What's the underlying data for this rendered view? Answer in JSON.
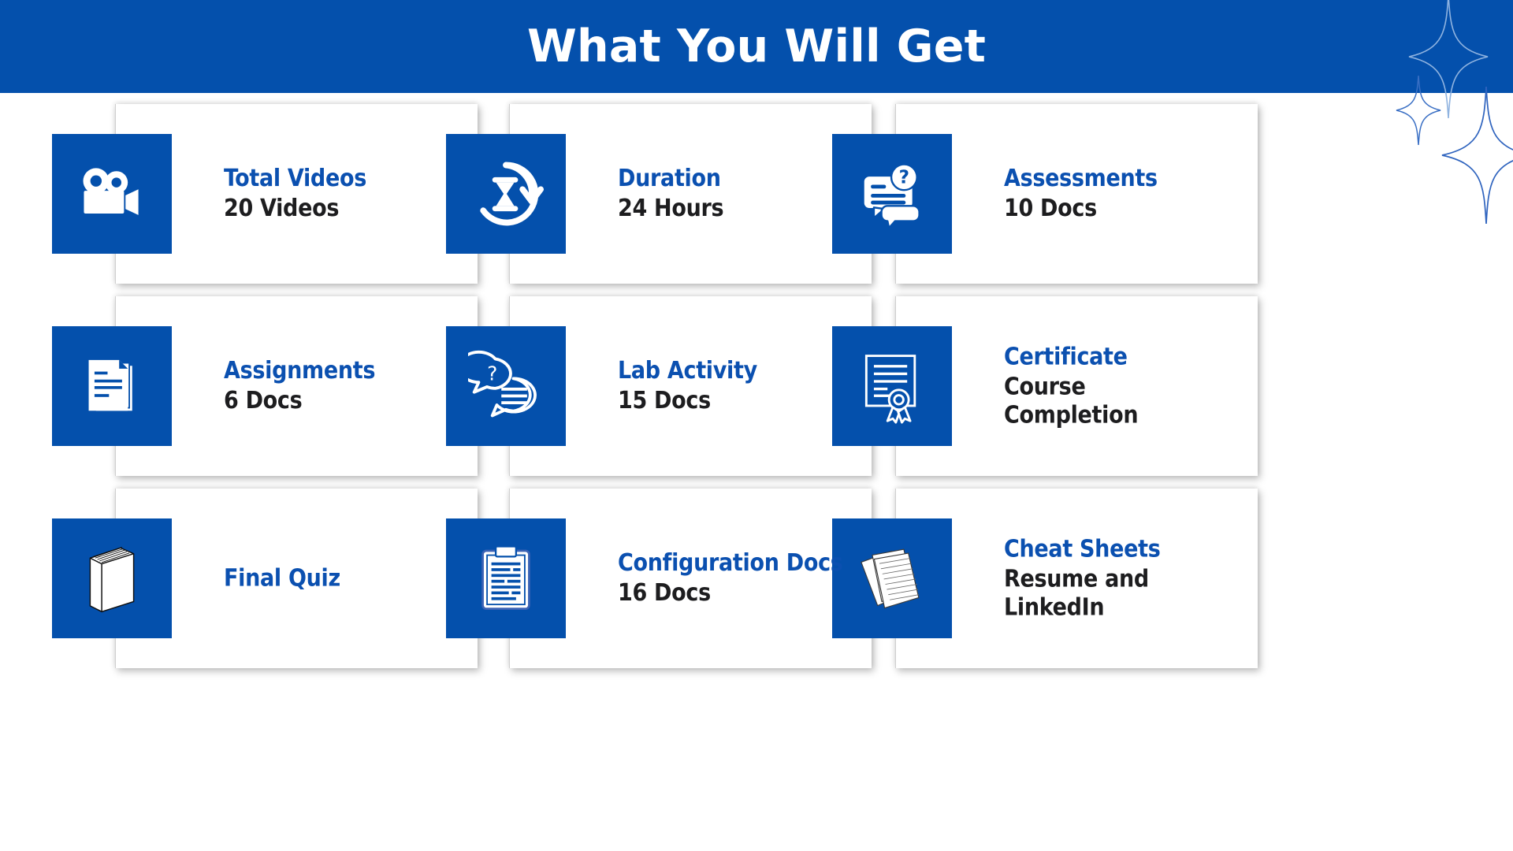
{
  "header": {
    "title": "What You Will Get",
    "background_color": "#0450AC",
    "title_color": "#FFFFFF"
  },
  "decoration": {
    "sparkle_icon_name": "four-point-star-sparkle",
    "stroke_color": "#3A6FC4",
    "count": 3
  },
  "theme": {
    "accent_blue": "#0450AC",
    "title_blue": "#0B50B0",
    "value_dark": "#1D1D1F",
    "card_background": "#FFFFFF",
    "page_background": "#FFFFFF"
  },
  "cards": [
    {
      "id": "total-videos",
      "icon": "video-camera-icon",
      "title": "Total Videos",
      "value": "20 Videos"
    },
    {
      "id": "duration",
      "icon": "hourglass-clock-icon",
      "title": "Duration",
      "value": "24 Hours"
    },
    {
      "id": "assessments",
      "icon": "question-chat-icon",
      "title": "Assessments",
      "value": "10 Docs"
    },
    {
      "id": "assignments",
      "icon": "documents-stack-icon",
      "title": "Assignments",
      "value": "6 Docs"
    },
    {
      "id": "lab-activity",
      "icon": "speech-bubbles-icon",
      "title": "Lab Activity",
      "value": "15 Docs"
    },
    {
      "id": "certificate",
      "icon": "certificate-icon",
      "title": "Certificate",
      "value": "Course Completion"
    },
    {
      "id": "final-quiz",
      "icon": "book-icon",
      "title": "Final Quiz",
      "value": ""
    },
    {
      "id": "configuration-docs",
      "icon": "clipboard-icon",
      "title": "Configuration Docs",
      "value": "16 Docs"
    },
    {
      "id": "cheat-sheets",
      "icon": "papers-stack-icon",
      "title": "Cheat Sheets",
      "value": "Resume and LinkedIn"
    }
  ]
}
